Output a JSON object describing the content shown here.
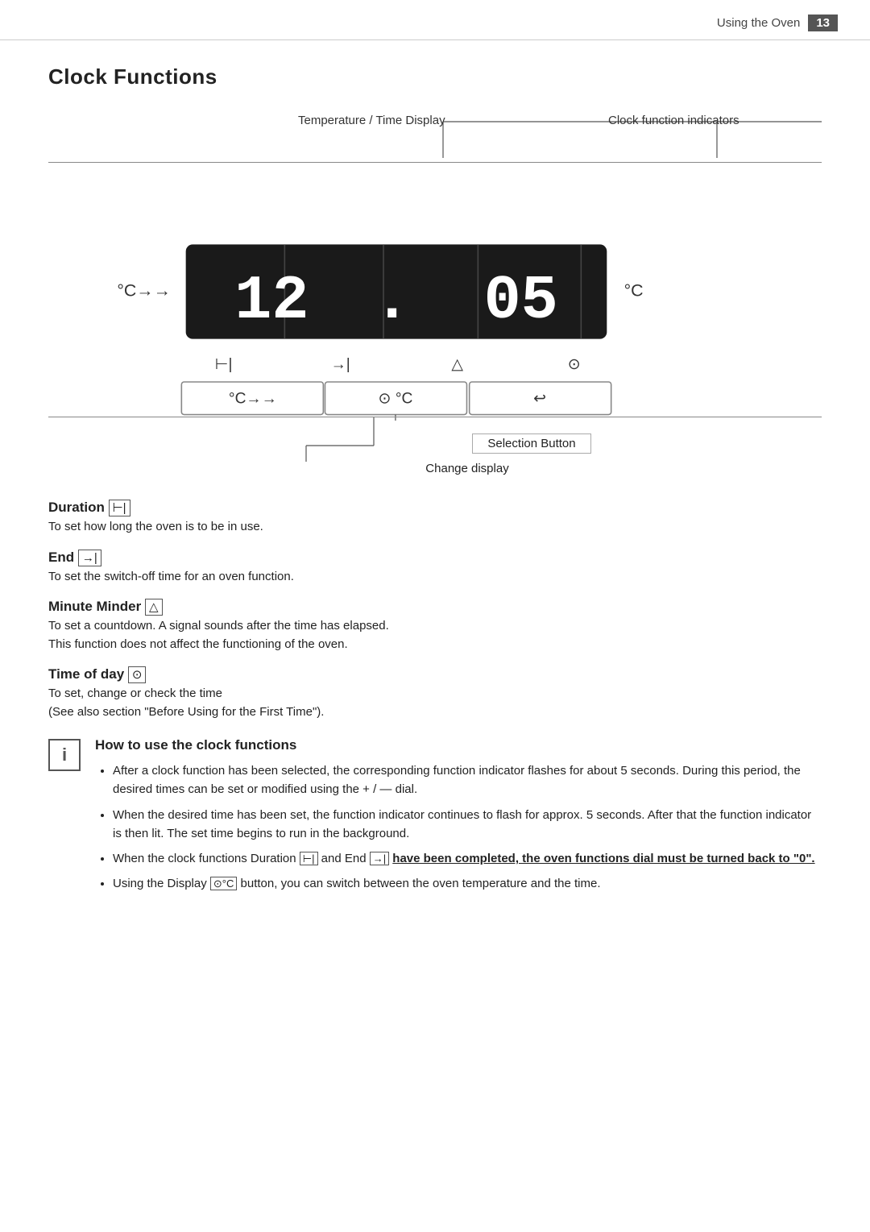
{
  "header": {
    "page_label": "Using the Oven",
    "page_number": "13"
  },
  "section": {
    "title": "Clock Functions"
  },
  "diagram": {
    "label_temp_time": "Temperature / Time Display",
    "label_clock_indicators": "Clock function indicators",
    "display_value": "12.05",
    "left_symbol": "°C→",
    "right_symbol": "°C",
    "icon_duration": "⊢|",
    "icon_end": "→|",
    "icon_minute": "△",
    "icon_time": "⊙",
    "bottom_labels": [
      "°C→→",
      "⊙ °C",
      "↩"
    ],
    "selection_button_label": "Selection Button",
    "change_display_label": "Change display"
  },
  "functions": [
    {
      "title": "Duration",
      "icon": "⊢|",
      "description": "To set how long the oven is to be in use."
    },
    {
      "title": "End",
      "icon": "→|",
      "description": "To set the switch-off time for an oven function."
    },
    {
      "title": "Minute Minder",
      "icon": "△",
      "description": "To set a countdown. A signal sounds after the time has elapsed.\nThis function does not affect the functioning of the oven."
    },
    {
      "title": "Time of day",
      "icon": "⊙",
      "description": "To set, change or check the time\n(See also section \"Before Using for the First Time\")."
    }
  ],
  "info": {
    "title": "How to use the clock functions",
    "bullets": [
      "After a clock function has been selected, the corresponding function indicator flashes for about 5 seconds. During this period, the desired times can be set or modified using the + / — dial.",
      "When the desired time has been set, the function indicator continues to flash for approx. 5 seconds. After that the function indicator is then lit. The set time begins to run in the background.",
      "When the clock functions Duration ⊢| and End →| have been completed, the oven functions dial must be turned back to \"0\".",
      "Using the  Display ⊙°C button, you can switch between the oven temperature and the time."
    ]
  }
}
